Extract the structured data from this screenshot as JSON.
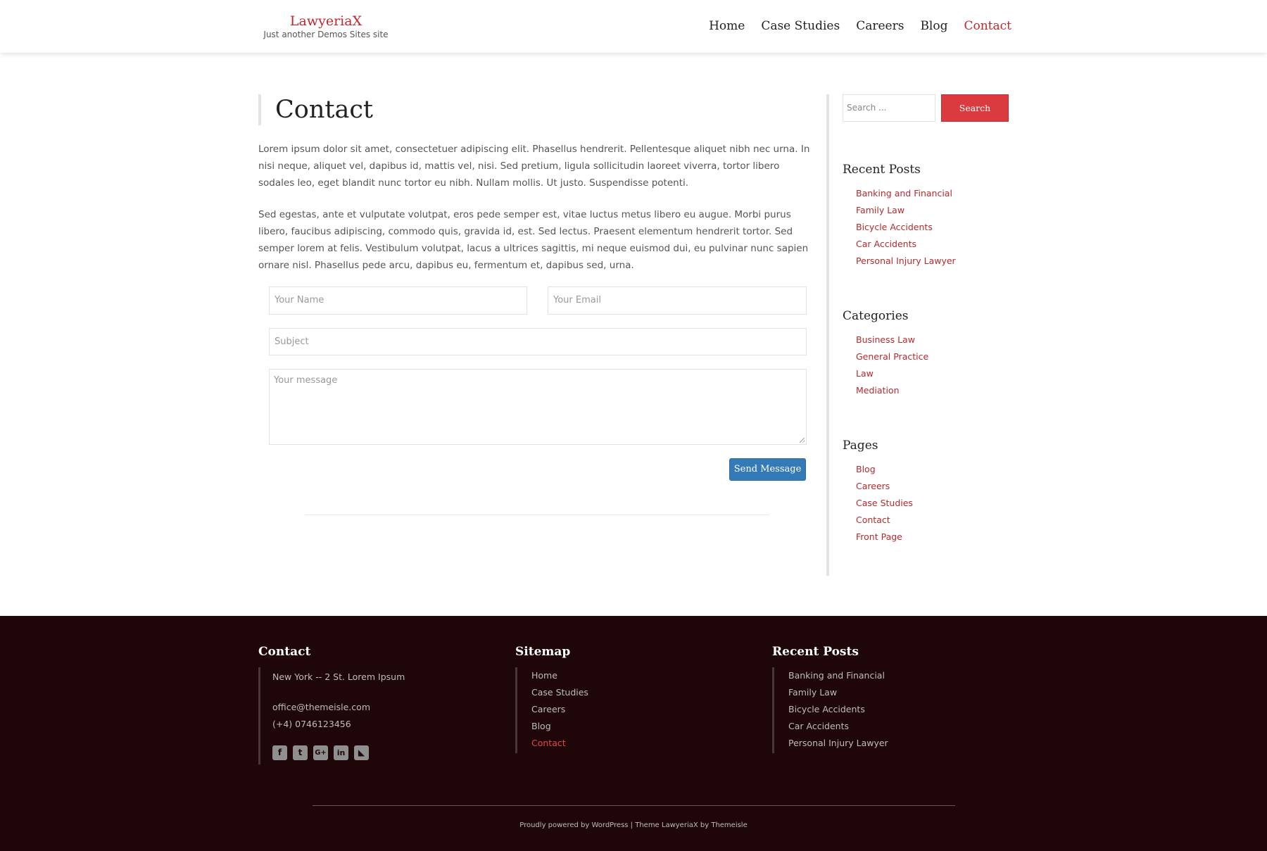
{
  "header": {
    "brand_title": "LawyeriaX",
    "brand_tagline": "Just another Demos Sites site",
    "nav": [
      {
        "label": "Home"
      },
      {
        "label": "Case Studies"
      },
      {
        "label": "Careers"
      },
      {
        "label": "Blog"
      },
      {
        "label": "Contact",
        "active": true
      }
    ]
  },
  "main": {
    "title": "Contact",
    "paragraphs": [
      "Lorem ipsum dolor sit amet, consectetuer adipiscing elit. Phasellus hendrerit. Pellentesque aliquet nibh nec urna. In nisi neque, aliquet vel, dapibus id, mattis vel, nisi. Sed pretium, ligula sollicitudin laoreet viverra, tortor libero sodales leo, eget blandit nunc tortor eu nibh. Nullam mollis. Ut justo. Suspendisse potenti.",
      "Sed egestas, ante et vulputate volutpat, eros pede semper est, vitae luctus metus libero eu augue. Morbi purus libero, faucibus adipiscing, commodo quis, gravida id, est. Sed lectus. Praesent elementum hendrerit tortor. Sed semper lorem at felis. Vestibulum volutpat, lacus a ultrices sagittis, mi neque euismod dui, eu pulvinar nunc sapien ornare nisl. Phasellus pede arcu, dapibus eu, fermentum et, dapibus sed, urna."
    ],
    "form": {
      "name_placeholder": "Your Name",
      "email_placeholder": "Your Email",
      "subject_placeholder": "Subject",
      "message_placeholder": "Your message",
      "submit_label": "Send Message"
    }
  },
  "sidebar": {
    "search_placeholder": "Search ...",
    "search_button": "Search",
    "recent_posts": {
      "title": "Recent Posts",
      "items": [
        "Banking and Financial",
        "Family Law",
        "Bicycle Accidents",
        "Car Accidents",
        "Personal Injury Lawyer"
      ]
    },
    "categories": {
      "title": "Categories",
      "items": [
        "Business Law",
        "General Practice",
        "Law",
        "Mediation"
      ]
    },
    "pages": {
      "title": "Pages",
      "items": [
        "Blog",
        "Careers",
        "Case Studies",
        "Contact",
        "Front Page"
      ]
    }
  },
  "footer": {
    "contact": {
      "title": "Contact",
      "address": "New York -- 2 St. Lorem Ipsum",
      "email": "office@themeisle.com",
      "phone": "(+4) 0746123456",
      "social_icons": [
        "facebook-icon",
        "twitter-icon",
        "google-plus-icon",
        "linkedin-icon",
        "rss-icon"
      ]
    },
    "sitemap": {
      "title": "Sitemap",
      "items": [
        "Home",
        "Case Studies",
        "Careers",
        "Blog",
        "Contact"
      ]
    },
    "recent_posts": {
      "title": "Recent Posts",
      "items": [
        "Banking and Financial",
        "Family Law",
        "Bicycle Accidents",
        "Car Accidents",
        "Personal Injury Lawyer"
      ]
    },
    "credits": "Proudly powered by WordPress | Theme LawyeriaX by Themeisle"
  },
  "colors": {
    "accent": "#c1272d",
    "link": "#b52a2e",
    "footer_bg": "#1f0608",
    "submit_button": "#337ab7",
    "search_button": "#da3b3e"
  }
}
